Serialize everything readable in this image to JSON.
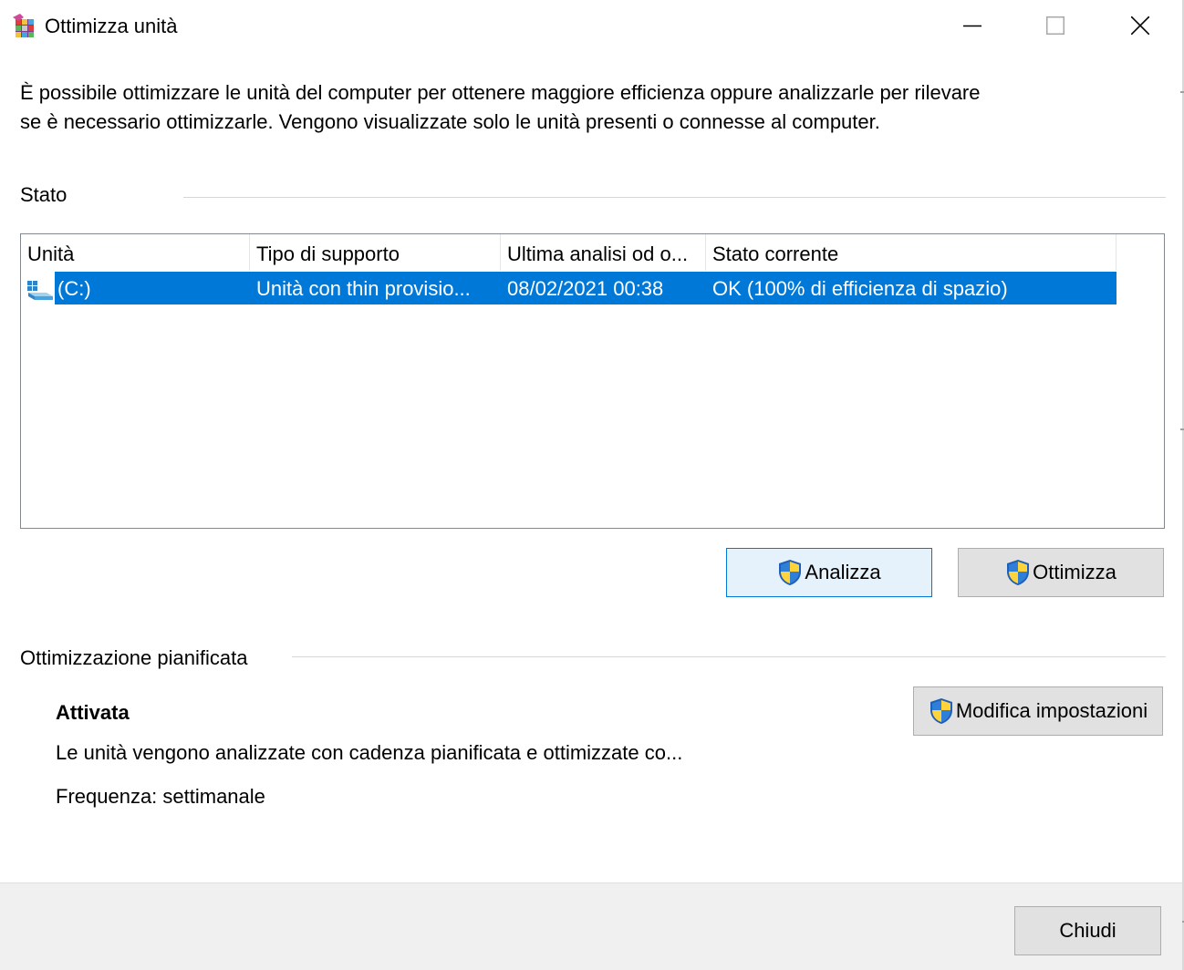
{
  "window": {
    "title": "Ottimizza unità",
    "app_icon": "defrag-icon",
    "caption_buttons": [
      "minimize-icon",
      "maximize-icon",
      "close-icon"
    ]
  },
  "description": {
    "line1": "È possibile ottimizzare le unità del computer per ottenere maggiore efficienza oppure analizzarle per rilevare",
    "line2": "se è necessario ottimizzarle. Vengono visualizzate solo le unità presenti o connesse al computer."
  },
  "status_section": {
    "label": "Stato",
    "columns": [
      "Unità",
      "Tipo di supporto",
      "Ultima analisi od o...",
      "Stato corrente"
    ],
    "rows": [
      {
        "drive": "(C:)",
        "media_type": "Unità con thin provisio...",
        "last_run": "08/02/2021 00:38",
        "status": "OK (100% di efficienza di spazio)",
        "selected": true,
        "icon": "drive-icon"
      }
    ],
    "selection_color": "#0078d7"
  },
  "actions": {
    "analyze_label": "Analizza",
    "optimize_label": "Ottimizza",
    "shield_icon": "uac-shield-icon"
  },
  "scheduled": {
    "label": "Ottimizzazione pianificata",
    "state": "Attivata",
    "description": "Le unità vengono analizzate con cadenza pianificata e ottimizzate co...",
    "frequency": "Frequenza: settimanale",
    "change_settings_label": "Modifica impostazioni"
  },
  "footer": {
    "close_label": "Chiudi"
  }
}
